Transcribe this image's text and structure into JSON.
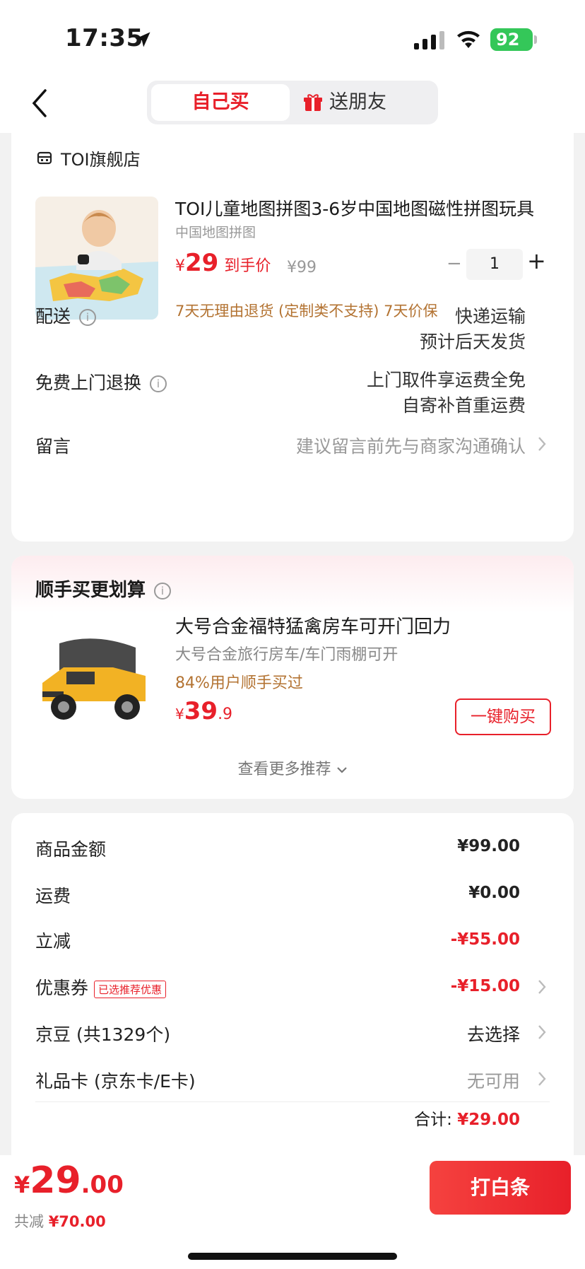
{
  "status_bar": {
    "time": "17:35",
    "battery": "92"
  },
  "header": {
    "tab_self": "自己买",
    "tab_gift": "送朋友"
  },
  "store": {
    "name": "TOI旗舰店"
  },
  "product": {
    "title": "TOI儿童地图拼图3-6岁中国地图磁性拼图玩具",
    "subtitle": "中国地图拼图",
    "price_symbol": "¥",
    "price": "29",
    "price_hint": "到手价",
    "original_price": "¥99",
    "quantity": "1",
    "policy": "7天无理由退货 (定制类不支持)   7天价保"
  },
  "delivery": {
    "label": "配送",
    "line1": "快递运输",
    "line2": "预计后天发货"
  },
  "return": {
    "label": "免费上门退换",
    "line1": "上门取件享运费全免",
    "line2": "自寄补首重运费"
  },
  "message": {
    "label": "留言",
    "placeholder": "建议留言前先与商家沟通确认"
  },
  "recommend": {
    "title": "顺手买更划算",
    "name": "大号合金福特猛禽房车可开门回力",
    "subtitle": "大号合金旅行房车/车门雨棚可开",
    "rate": "84%用户顺手买过",
    "price_symbol": "¥",
    "price_int": "39",
    "price_dec": ".9",
    "buy_label": "一键购买",
    "more_label": "查看更多推荐"
  },
  "summary": {
    "rows": [
      {
        "label": "商品金额",
        "value": "¥99.00"
      },
      {
        "label": "运费",
        "value": "¥0.00"
      },
      {
        "label": "立减",
        "value": "-¥55.00"
      },
      {
        "label": "优惠券",
        "badge": "已选推荐优惠",
        "value": "-¥15.00"
      },
      {
        "label": "京豆 (共1329个)",
        "value": "去选择"
      },
      {
        "label": "礼品卡 (京东卡/E卡)",
        "value": "无可用"
      }
    ],
    "total_label": "合计: ",
    "total_value": "¥29.00"
  },
  "bottom": {
    "price_symbol": "¥",
    "price_int": "29",
    "price_dec": ".00",
    "save_label": "共减 ",
    "save_value": "¥70.00",
    "pay_label": "打白条"
  }
}
